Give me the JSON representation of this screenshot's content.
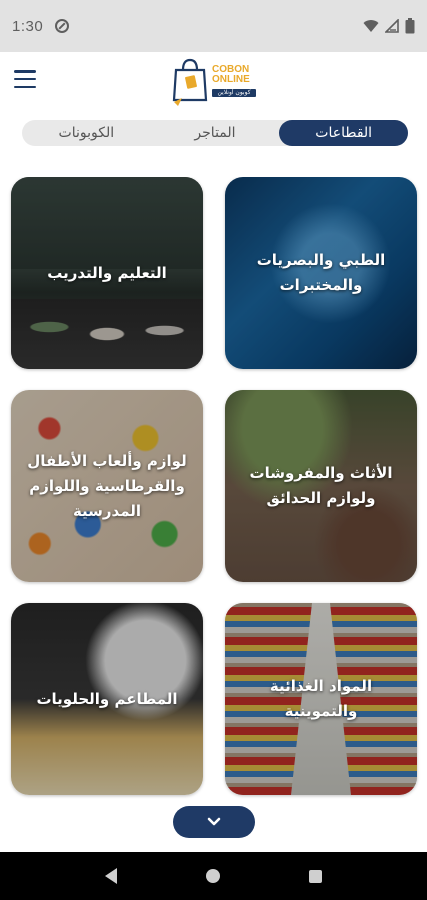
{
  "status_bar": {
    "time": "1:30"
  },
  "app": {
    "logo_text_line1": "COBON",
    "logo_text_line2": "ONLINE",
    "logo_text_arabic": "كوبون أونلاين"
  },
  "tabs": [
    {
      "label": "القطاعات",
      "active": true
    },
    {
      "label": "المتاجر",
      "active": false
    },
    {
      "label": "الكوبونات",
      "active": false
    }
  ],
  "categories": [
    {
      "title": "الطبي والبصريات والمختبرات"
    },
    {
      "title": "التعليم والتدريب"
    },
    {
      "title": "الأثاث والمفروشات ولوازم الحدائق"
    },
    {
      "title": "لوازم وألعاب الأطفال والقرطاسية واللوازم المدرسية"
    },
    {
      "title": "المواد الغذائية والتموينية"
    },
    {
      "title": "المطاعم والحلويات"
    }
  ],
  "icons": {
    "menu": "hamburger-menu-icon",
    "scroll": "chevron-down-icon",
    "status": [
      "dnd-icon",
      "wifi-icon",
      "signal-icon",
      "battery-icon"
    ],
    "nav": [
      "back-icon",
      "home-icon",
      "recent-apps-icon"
    ]
  },
  "colors": {
    "primary": "#1f3a66",
    "accent": "#e9a92b",
    "tab_inactive_bg": "#e9e9e9"
  }
}
